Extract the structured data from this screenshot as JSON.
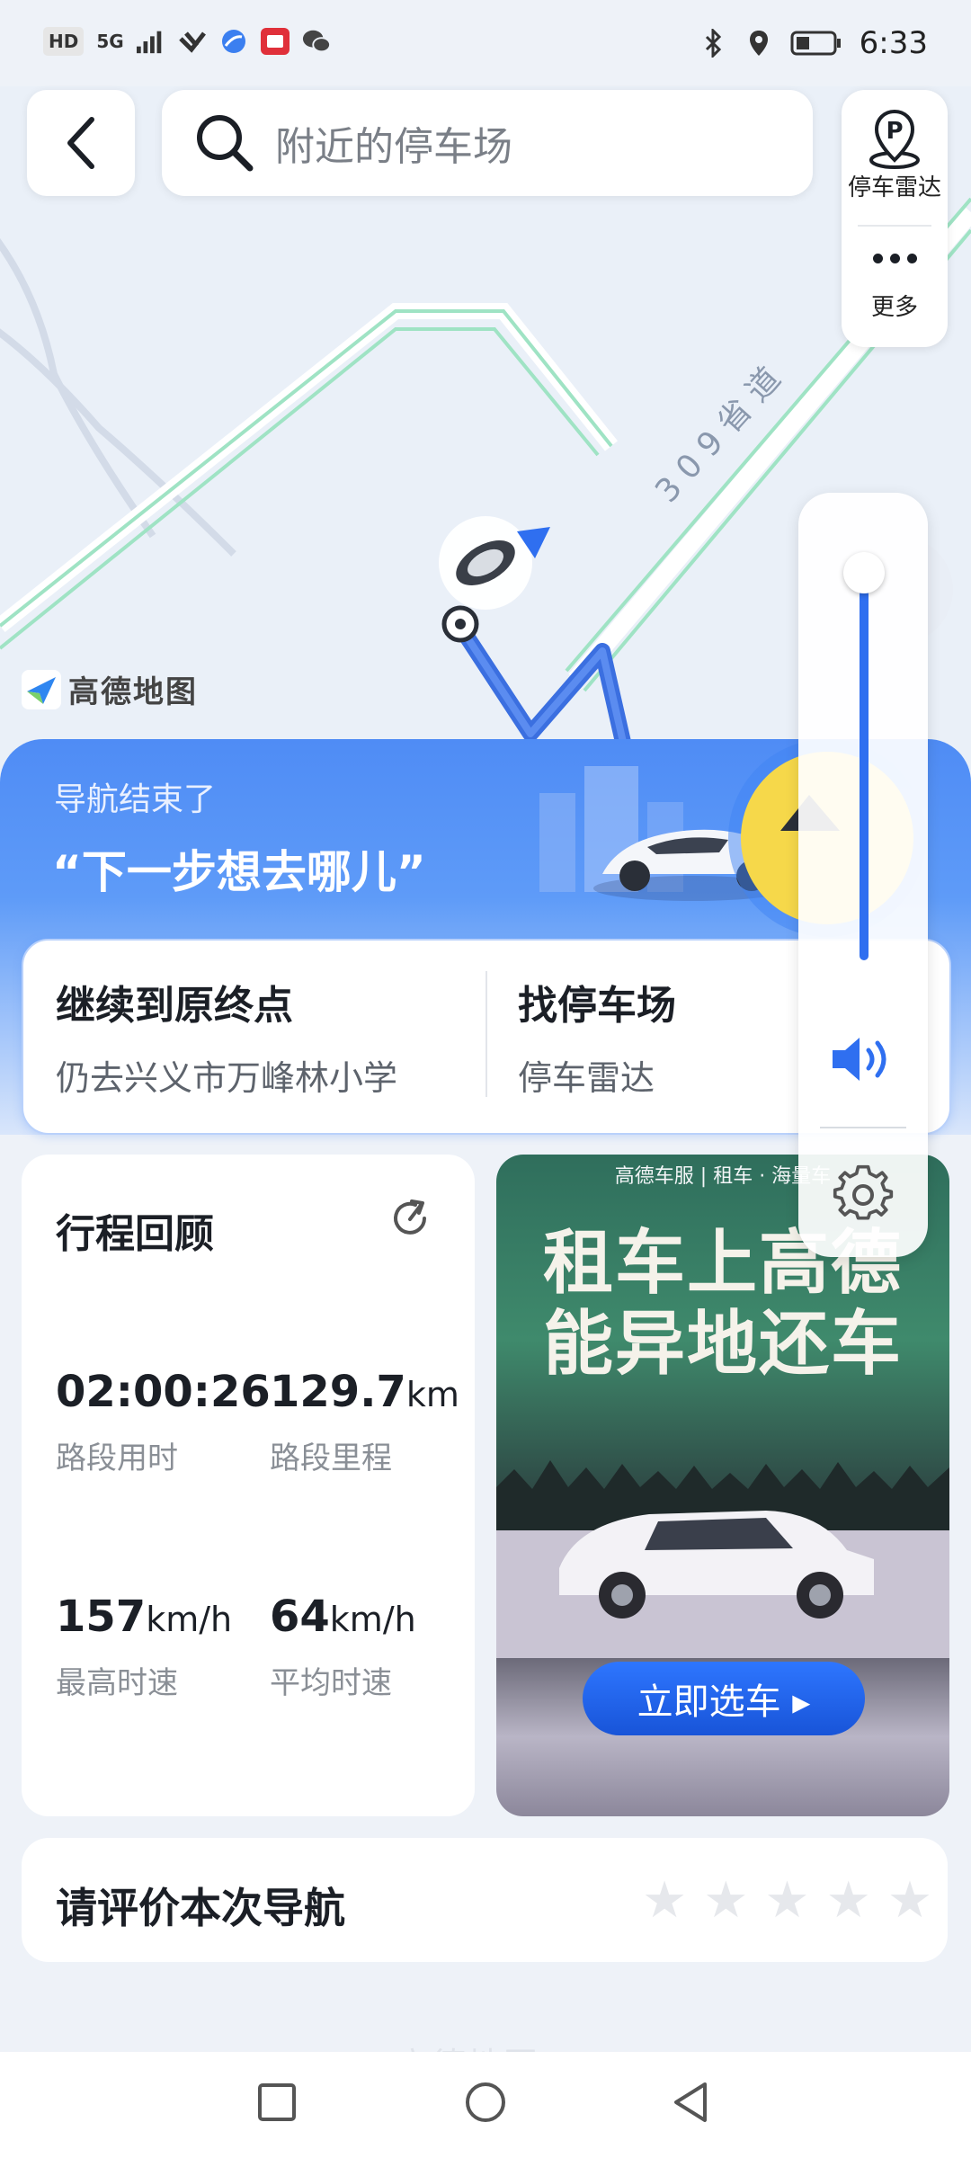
{
  "status_bar": {
    "left_chip": "HD",
    "network": "5G",
    "time": "6:33",
    "icons": [
      "signal-icon",
      "wifi-icon",
      "browser-icon",
      "app-icon",
      "wechat-icon",
      "bluetooth-icon",
      "location-icon",
      "battery-icon"
    ]
  },
  "search": {
    "placeholder": "附近的停车场"
  },
  "side_panel": {
    "parking_radar_label": "停车雷达",
    "more_label": "更多"
  },
  "map": {
    "road_label": "3 0 9 省 道",
    "logo_text": "高德地图"
  },
  "banner": {
    "subtitle": "导航结束了",
    "title": "“下一步想去哪儿”"
  },
  "destinations": [
    {
      "title": "继续到原终点",
      "subtitle": "仍去兴义市万峰林小学"
    },
    {
      "title": "找停车场",
      "subtitle": "停车雷达"
    }
  ],
  "volume": {
    "level": 1.0
  },
  "trip_review": {
    "title": "行程回顾",
    "stats": [
      {
        "value": "02:00:26",
        "unit": "",
        "label": "路段用时"
      },
      {
        "value": "129.7",
        "unit": "km",
        "label": "路段里程"
      },
      {
        "value": "157",
        "unit": "km/h",
        "label": "最高时速"
      },
      {
        "value": "64",
        "unit": "km/h",
        "label": "平均时速"
      }
    ]
  },
  "ad": {
    "header": "高德车服 | 租车 · 海量车",
    "headline_1": "租车上高德",
    "headline_2": "能异地还车",
    "cta": "立即选车 ▸"
  },
  "rating": {
    "title": "请评价本次导航",
    "stars": 5,
    "selected": 0
  },
  "footer": {
    "logo": "高德地图"
  },
  "colors": {
    "accent": "#2f6ff0",
    "banner": "#4f8cf5",
    "road": "#8fe0b8",
    "route": "#3b6fe0"
  }
}
